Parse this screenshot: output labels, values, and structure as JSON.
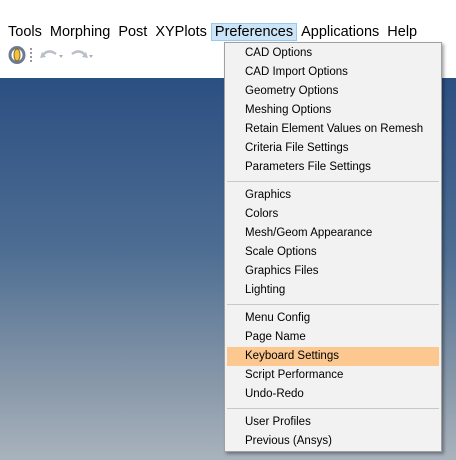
{
  "menubar": {
    "items": [
      {
        "label": "Tools"
      },
      {
        "label": "Morphing"
      },
      {
        "label": "Post"
      },
      {
        "label": "XYPlots"
      },
      {
        "label": "Preferences"
      },
      {
        "label": "Applications"
      },
      {
        "label": "Help"
      }
    ],
    "active": "Preferences"
  },
  "toolbar": {
    "icons": [
      "app-icon",
      "grip-icon",
      "undo-icon",
      "redo-icon"
    ]
  },
  "preferences_menu": {
    "groups": [
      [
        "CAD Options",
        "CAD Import Options",
        "Geometry Options",
        "Meshing Options",
        "Retain Element Values on Remesh",
        "Criteria File Settings",
        "Parameters File Settings"
      ],
      [
        "Graphics",
        "Colors",
        "Mesh/Geom Appearance",
        "Scale Options",
        "Graphics Files",
        "Lighting"
      ],
      [
        "Menu Config",
        "Page Name",
        "Keyboard Settings",
        "Script Performance",
        "Undo-Redo"
      ],
      [
        "User Profiles",
        "Previous (Ansys)"
      ]
    ],
    "highlighted": "Keyboard Settings"
  },
  "colors": {
    "highlight": "#fcc890",
    "active_menu_bg": "#cce4f7",
    "viewport_top": "#2c4f82",
    "viewport_bottom": "#a9b3bd"
  }
}
